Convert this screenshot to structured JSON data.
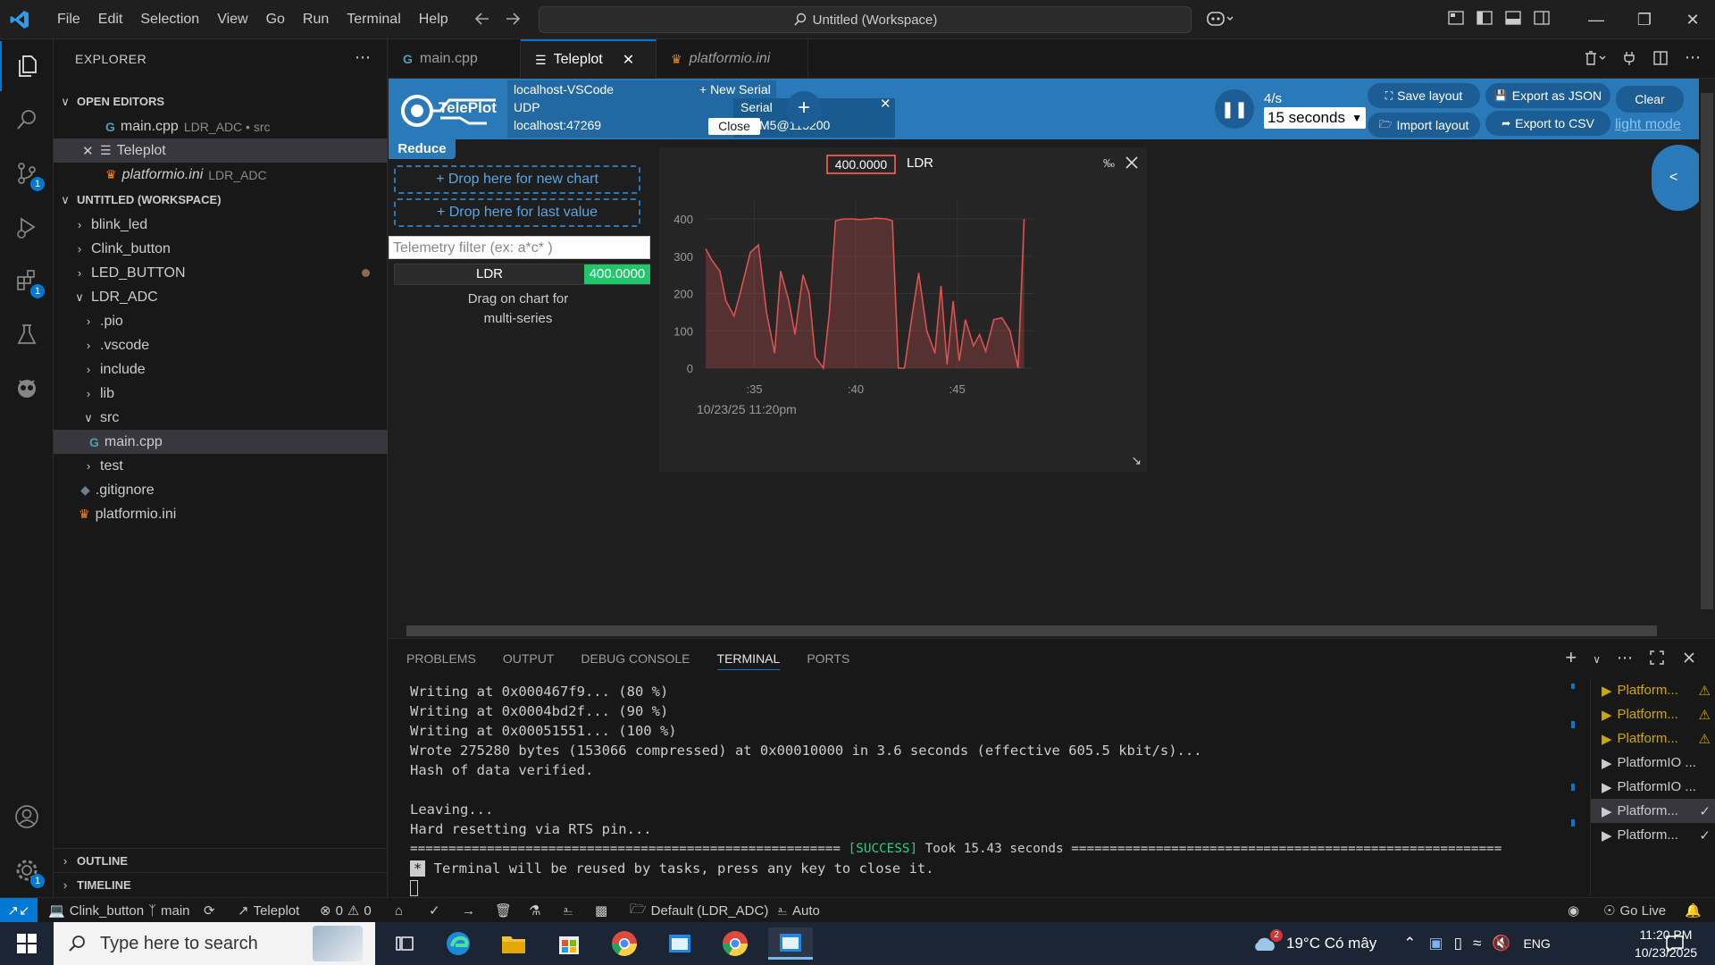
{
  "window": {
    "menu": [
      "File",
      "Edit",
      "Selection",
      "View",
      "Go",
      "Run",
      "Terminal",
      "Help"
    ],
    "command_center": "Untitled (Workspace)"
  },
  "activity_badges": {
    "source_control": "1",
    "extensions": "1",
    "settings": "1"
  },
  "sidebar": {
    "title": "EXPLORER",
    "open_editors_label": "OPEN EDITORS",
    "open_editors": [
      {
        "name": "main.cpp",
        "desc": "LDR_ADC • src"
      },
      {
        "name": "Teleplot",
        "desc": ""
      },
      {
        "name": "platformio.ini",
        "desc": "LDR_ADC"
      }
    ],
    "workspace_label": "UNTITLED (WORKSPACE)",
    "tree": [
      "blink_led",
      "Clink_button",
      "LED_BUTTON",
      "LDR_ADC",
      ".pio",
      ".vscode",
      "include",
      "lib",
      "src",
      "main.cpp",
      "test",
      ".gitignore",
      "platformio.ini"
    ],
    "outline_label": "OUTLINE",
    "timeline_label": "TIMELINE"
  },
  "tabs": [
    {
      "label": "main.cpp"
    },
    {
      "label": "Teleplot"
    },
    {
      "label": "platformio.ini"
    }
  ],
  "teleplot": {
    "logo_text": "TelePlot",
    "conn_name": "localhost-VSCode",
    "new_serial": "+ New Serial",
    "udp_label": "UDP",
    "udp_addr": "localhost:47269",
    "serial_label": "Serial",
    "serial_port": "COM5@115200",
    "close_label": "Close",
    "add_label": "+",
    "rate": "4/s",
    "duration": "15 seconds",
    "save_layout": "Save layout",
    "import_layout": "Import layout",
    "export_json": "Export as JSON",
    "export_csv": "Export to CSV",
    "clear": "Clear",
    "light_mode": "light mode",
    "reduce": "Reduce",
    "drop_new_chart": "+ Drop here for new chart",
    "drop_last_value": "+ Drop here for last value",
    "filter_placeholder": "Telemetry filter (ex: a*c* )",
    "telemetry_name": "LDR",
    "telemetry_value": "400.0000",
    "drag_hint_1": "Drag on chart for",
    "drag_hint_2": "multi-series",
    "side_toggle": "<"
  },
  "chart_data": {
    "type": "area",
    "series": [
      {
        "name": "LDR",
        "x": [
          32.6,
          32.9,
          33.3,
          33.6,
          34.0,
          34.3,
          34.8,
          35.2,
          35.6,
          36.0,
          36.3,
          36.7,
          37.0,
          37.4,
          37.7,
          38.0,
          38.4,
          38.7,
          39.0,
          39.4,
          39.8,
          40.2,
          40.6,
          41.0,
          41.5,
          41.8,
          42.1,
          42.4,
          42.8,
          43.1,
          43.5,
          43.9,
          44.2,
          44.5,
          44.8,
          45.1,
          45.4,
          45.8,
          46.1,
          46.4,
          46.8,
          47.2,
          47.6,
          48.0,
          48.3
        ],
        "y": [
          320,
          290,
          260,
          180,
          140,
          200,
          310,
          330,
          150,
          40,
          260,
          180,
          90,
          250,
          200,
          30,
          0,
          150,
          395,
          400,
          400,
          398,
          400,
          402,
          400,
          395,
          0,
          0,
          150,
          255,
          100,
          40,
          220,
          10,
          180,
          20,
          130,
          60,
          90,
          45,
          130,
          135,
          100,
          0,
          400
        ]
      }
    ],
    "x_ticks": [
      ":35",
      ":40",
      ":45"
    ],
    "y_ticks": [
      "0",
      "100",
      "200",
      "300",
      "400"
    ],
    "ylim": [
      0,
      400
    ],
    "x_range": [
      32.6,
      48.8
    ],
    "xlabel": "10/23/25 11:20pm",
    "value_box": "400.0000",
    "legend_label": "LDR",
    "ylabel": ""
  },
  "panel": {
    "tabs": [
      "PROBLEMS",
      "OUTPUT",
      "DEBUG CONSOLE",
      "TERMINAL",
      "PORTS"
    ],
    "terminal_lines": [
      "Writing at 0x000467f9... (80 %)",
      "Writing at 0x0004bd2f... (90 %)",
      "Writing at 0x00051551... (100 %)",
      "Wrote 275280 bytes (153066 compressed) at 0x00010000 in 3.6 seconds (effective 605.5 kbit/s)...",
      "Hash of data verified.",
      "",
      "Leaving...",
      "Hard resetting via RTS pin..."
    ],
    "success_prefix": "======================================================== ",
    "success_word": "[SUCCESS]",
    "success_suffix": " Took 15.43 seconds ========================================================",
    "reuse_star": "*",
    "reuse_msg": " Terminal will be reused by tasks, press any key to close it.",
    "terminals": [
      {
        "label": "Platform...",
        "state": "warn"
      },
      {
        "label": "Platform...",
        "state": "warn"
      },
      {
        "label": "Platform...",
        "state": "warn"
      },
      {
        "label": "PlatformIO ...",
        "state": "none"
      },
      {
        "label": "PlatformIO ...",
        "state": "none"
      },
      {
        "label": "Platform...",
        "state": "check"
      },
      {
        "label": "Platform...",
        "state": "check"
      }
    ]
  },
  "statusbar": {
    "project": "Clink_button",
    "branch": "main",
    "teleplot": "Teleplot",
    "errors": "0",
    "warnings": "0",
    "env": "Default (LDR_ADC)",
    "auto": "Auto",
    "golive": "Go Live"
  },
  "taskbar": {
    "search_placeholder": "Type here to search",
    "weather": "19°C  Có mây",
    "weather_badge": "2",
    "lang": "ENG",
    "time": "11:20 PM",
    "date": "10/23/2025"
  },
  "colors": {
    "accent": "#0078d4",
    "teleplot_blue": "#2a79b9",
    "series": "#d9534f",
    "success": "#23d18b",
    "warn": "#cca700"
  }
}
